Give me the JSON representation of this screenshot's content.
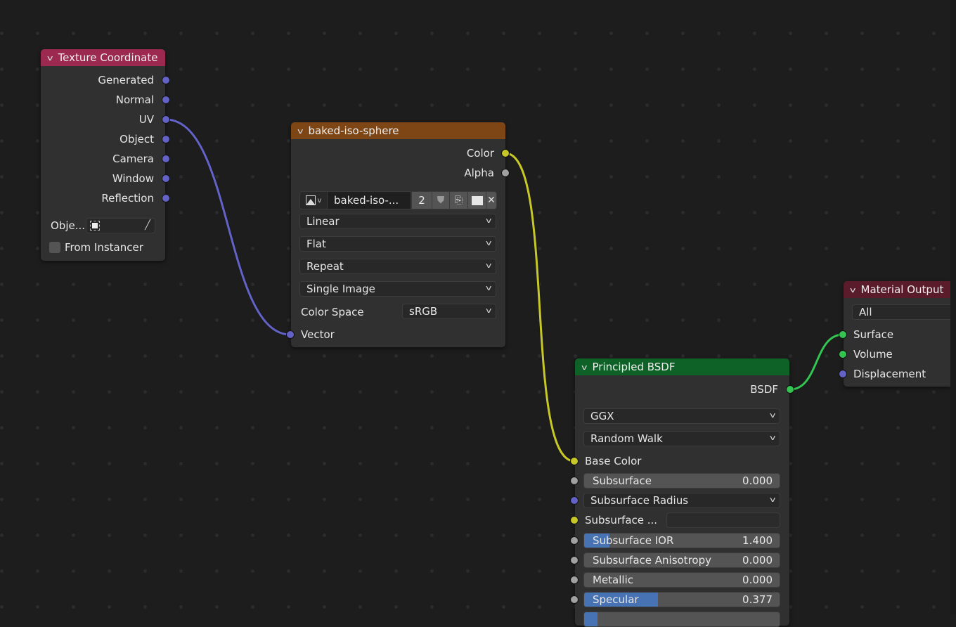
{
  "editor": "Shader Editor - node tree",
  "nodes": {
    "texture_coordinate": {
      "title": "Texture Coordinate",
      "header_color": "#9c2a50",
      "outputs": [
        "Generated",
        "Normal",
        "UV",
        "Object",
        "Camera",
        "Window",
        "Reflection"
      ],
      "object_label": "Obje...",
      "object_value": "",
      "from_instancer_label": "From Instancer",
      "from_instancer_checked": false
    },
    "image_texture": {
      "title": "baked-iso-sphere",
      "header_color": "#7e4615",
      "outputs": [
        "Color",
        "Alpha"
      ],
      "image_name": "baked-iso-...",
      "user_count": "2",
      "interpolation": "Linear",
      "projection": "Flat",
      "extension": "Repeat",
      "source": "Single Image",
      "color_space_label": "Color Space",
      "color_space": "sRGB",
      "inputs": [
        "Vector"
      ]
    },
    "principled_bsdf": {
      "title": "Principled BSDF",
      "header_color": "#0e6227",
      "output": "BSDF",
      "distribution": "GGX",
      "subsurface_method": "Random Walk",
      "base_color_label": "Base Color",
      "fields": [
        {
          "label": "Subsurface",
          "value": "0.000",
          "fill": 0
        },
        {
          "label": "Subsurface Radius",
          "type": "dropdown"
        },
        {
          "label": "Subsurface ...",
          "type": "color"
        },
        {
          "label": "Subsurface IOR",
          "value": "1.400",
          "fill": 0.13
        },
        {
          "label": "Subsurface Anisotropy",
          "value": "0.000",
          "fill": 0
        },
        {
          "label": "Metallic",
          "value": "0.000",
          "fill": 0
        },
        {
          "label": "Specular",
          "value": "0.377",
          "fill": 0.377
        }
      ]
    },
    "material_output": {
      "title": "Material Output",
      "header_color": "#5a1b2b",
      "target": "All",
      "inputs": [
        "Surface",
        "Volume",
        "Displacement"
      ]
    }
  },
  "links": [
    {
      "from": "Texture Coordinate.UV",
      "to": "baked-iso-sphere.Vector",
      "color": "#6363c7"
    },
    {
      "from": "baked-iso-sphere.Color",
      "to": "Principled BSDF.Base Color",
      "color": "#c7c729"
    },
    {
      "from": "Principled BSDF.BSDF",
      "to": "Material Output.Surface",
      "color": "#33c451"
    }
  ]
}
